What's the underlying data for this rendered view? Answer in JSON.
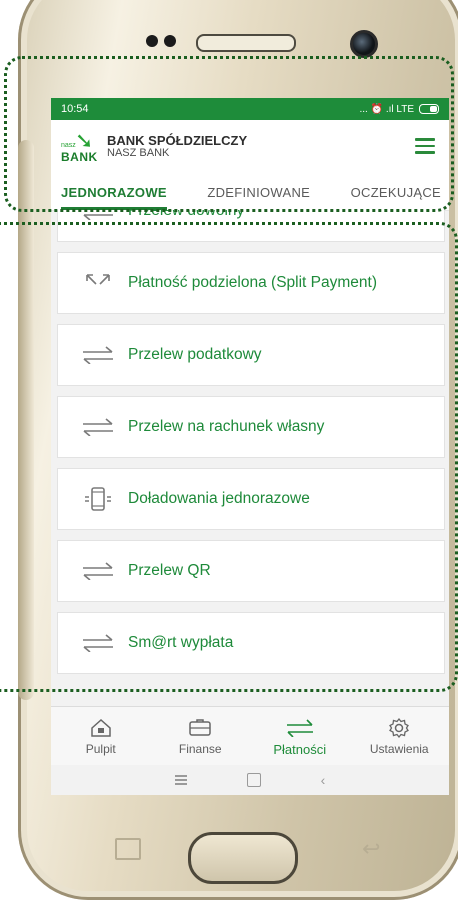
{
  "status": {
    "time": "10:54",
    "network": "... ⏰ .ıl LTE"
  },
  "header": {
    "brand_small": "nasz",
    "brand_big": "BANK",
    "title": "BANK SPÓŁDZIELCZY",
    "subtitle": "NASZ BANK"
  },
  "tabs": [
    {
      "label": "JEDNORAZOWE",
      "active": true
    },
    {
      "label": "ZDEFINIOWANE",
      "active": false
    },
    {
      "label": "OCZEKUJĄCE",
      "active": false
    }
  ],
  "transfers": [
    {
      "label": "Przelew dowolny",
      "icon": "transfer-arrows-icon"
    },
    {
      "label": "Płatność podzielona (Split Payment)",
      "icon": "split-arrows-icon"
    },
    {
      "label": "Przelew podatkowy",
      "icon": "transfer-arrows-icon"
    },
    {
      "label": "Przelew na rachunek własny",
      "icon": "transfer-arrows-icon"
    },
    {
      "label": "Doładowania jednorazowe",
      "icon": "phone-topup-icon"
    },
    {
      "label": "Przelew QR",
      "icon": "transfer-arrows-icon"
    },
    {
      "label": "Sm@rt wypłata",
      "icon": "transfer-arrows-icon"
    }
  ],
  "nav": [
    {
      "label": "Pulpit",
      "icon": "home-icon",
      "active": false
    },
    {
      "label": "Finanse",
      "icon": "wallet-icon",
      "active": false
    },
    {
      "label": "Płatności",
      "icon": "transfer-arrows-icon",
      "active": true
    },
    {
      "label": "Ustawienia",
      "icon": "gear-icon",
      "active": false
    }
  ],
  "colors": {
    "accent": "#1f8c3a",
    "statusbar": "#1e8c3a",
    "highlight": "#1b5e20"
  }
}
